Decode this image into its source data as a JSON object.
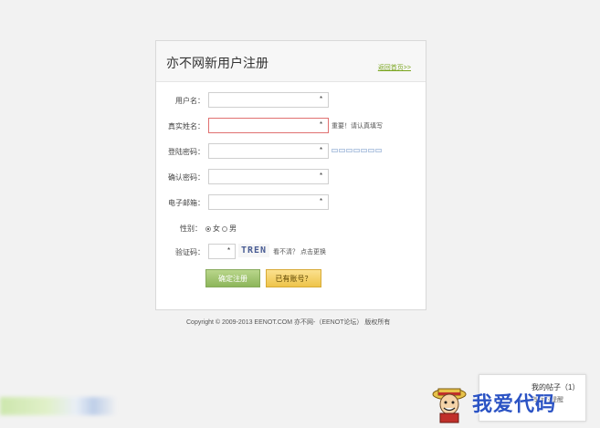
{
  "panel": {
    "title": "亦不网新用户注册",
    "back_link": "返回首页>>"
  },
  "form": {
    "username": {
      "label": "用户名：",
      "required_mark": "*"
    },
    "realname": {
      "label": "真实姓名：",
      "required_mark": "*",
      "hint": "重要！请认真填写"
    },
    "password": {
      "label": "登陆密码：",
      "required_mark": "*"
    },
    "confirm": {
      "label": "确认密码：",
      "required_mark": "*"
    },
    "email": {
      "label": "电子邮箱：",
      "required_mark": "*"
    },
    "gender": {
      "label": "性别：",
      "option_female": "女",
      "option_male": "男"
    },
    "captcha": {
      "label": "验证码：",
      "required_mark": "*",
      "code": "TREN",
      "hint": "看不清？ 点击更换"
    },
    "submit_label": "确定注册",
    "login_label": "已有账号？"
  },
  "footer": {
    "text": "Copyright © 2009-2013 EENOT.COM 亦不网-（EENOT论坛） 版权所有"
  },
  "post_box": {
    "title": "我的帖子（1）",
    "subtitle": "有新的提醒"
  },
  "watermark": {
    "text": "我爱代码"
  }
}
